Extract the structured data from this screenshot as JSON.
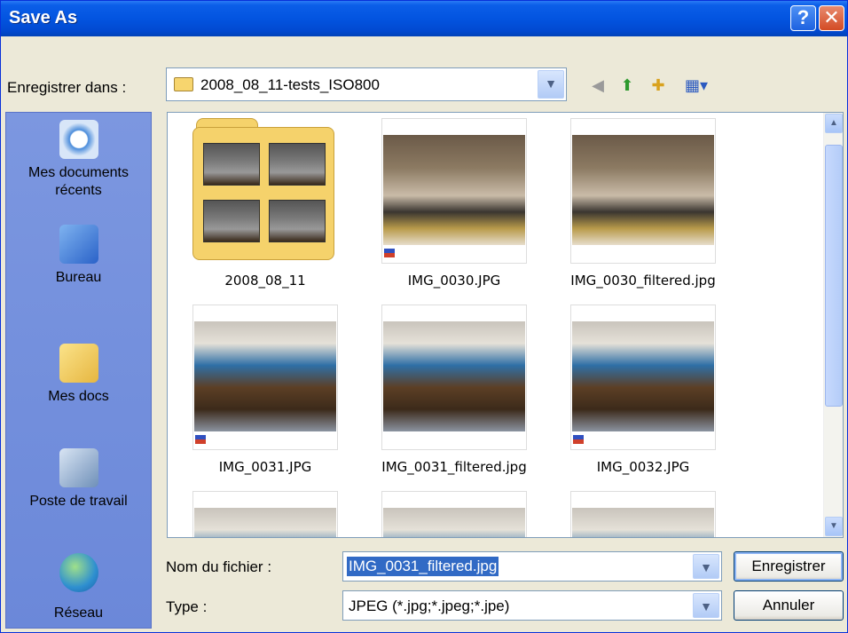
{
  "window": {
    "title": "Save As",
    "help_glyph": "?",
    "close_glyph": "✕"
  },
  "save_in": {
    "label": "Enregistrer dans :",
    "value": "2008_08_11-tests_ISO800"
  },
  "toolbar": {
    "back_icon": "back-icon",
    "up_icon": "up-folder-icon",
    "new_folder_icon": "new-folder-icon",
    "views_icon": "views-menu-icon"
  },
  "places": [
    {
      "label": "Mes documents récents",
      "icon": "recent-documents-icon"
    },
    {
      "label": "Bureau",
      "icon": "desktop-icon"
    },
    {
      "label": "Mes docs",
      "icon": "my-documents-icon"
    },
    {
      "label": "Poste de travail",
      "icon": "my-computer-icon"
    },
    {
      "label": "Réseau",
      "icon": "network-icon"
    }
  ],
  "files": [
    {
      "name": "2008_08_11",
      "kind": "folder"
    },
    {
      "name": "IMG_0030.JPG",
      "kind": "photo"
    },
    {
      "name": "IMG_0030_filtered.jpg",
      "kind": "photo"
    },
    {
      "name": "IMG_0031.JPG",
      "kind": "photo"
    },
    {
      "name": "IMG_0031_filtered.jpg",
      "kind": "photo"
    },
    {
      "name": "IMG_0032.JPG",
      "kind": "photo"
    }
  ],
  "filename": {
    "label": "Nom du fichier :",
    "value": "IMG_0031_filtered.jpg"
  },
  "filetype": {
    "label": "Type :",
    "value": "JPEG (*.jpg;*.jpeg;*.jpe)"
  },
  "buttons": {
    "save": "Enregistrer",
    "cancel": "Annuler"
  },
  "colors": {
    "titlebar": "#0354E0",
    "places_bg": "#7A96DF",
    "selection": "#316AC5",
    "dialog_bg": "#ECE9D8"
  }
}
